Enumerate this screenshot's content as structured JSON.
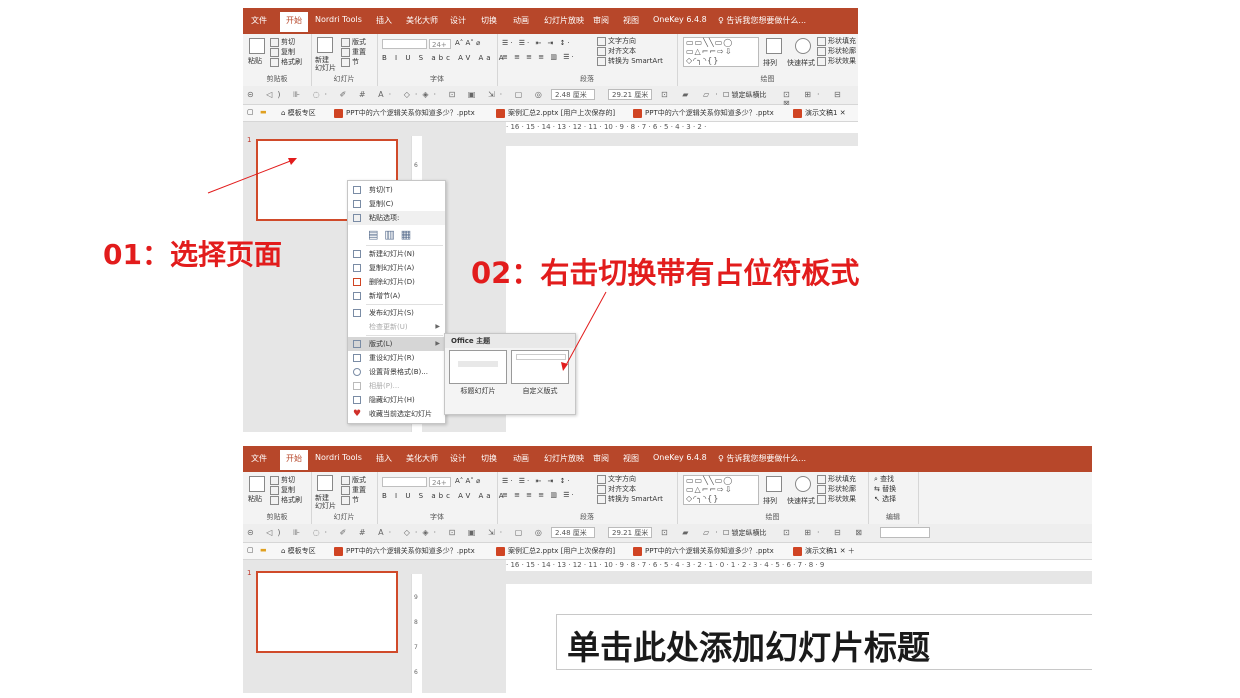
{
  "ribbon": {
    "tabs": [
      "文件",
      "开始",
      "Nordri Tools",
      "插入",
      "美化大师",
      "设计",
      "切换",
      "动画",
      "幻灯片放映",
      "审阅",
      "视图",
      "OneKey 6.4.8"
    ],
    "tell_me": "告诉我您想要做什么...",
    "clipboard": {
      "paste": "粘贴",
      "cut": "剪切",
      "copy": "复制",
      "format_painter": "格式刷",
      "label": "剪贴板"
    },
    "slides": {
      "new_slide": "新建\n幻灯片",
      "layout": "版式",
      "reset": "重置",
      "section": "节",
      "label": "幻灯片"
    },
    "font": {
      "size": "24+",
      "label": "字体"
    },
    "paragraph": {
      "text_direction": "文字方向",
      "align_text": "对齐文本",
      "smartart": "转换为 SmartArt",
      "label": "段落"
    },
    "drawing": {
      "arrange": "排列",
      "quick_styles": "快速样式",
      "shape_fill": "形状填充",
      "shape_outline": "形状轮廓",
      "shape_effects": "形状效果",
      "label": "绘图"
    },
    "editing": {
      "find": "查找",
      "replace": "替换",
      "select": "选择",
      "label": "编辑"
    }
  },
  "quick_toolbar": {
    "width_value": "2.48 厘米",
    "height_value": "29.21 厘米",
    "lock_ratio": "锁定纵横比"
  },
  "doc_tabs": {
    "template": "模板专区",
    "tabs_top": [
      "PPT中的六个逻辑关系你知道多少？.pptx",
      "案例汇总2.pptx [用户上次保存的]",
      "PPT中的六个逻辑关系你知道多少？.pptx",
      "演示文稿1"
    ],
    "tabs_bottom": [
      "PPT中的六个逻辑关系你知道多少？.pptx",
      "案例汇总2.pptx [用户上次保存的]",
      "PPT中的六个逻辑关系你知道多少？.pptx",
      "演示文稿1"
    ]
  },
  "ruler_top": "· 16 · 15 · 14 · 13 · 12 · 11 · 10 · 9 · 8 · 7 · 6 · 5 · 4 · 3 · 2 ·",
  "ruler_bottom": "· 16 · 15 · 14 · 13 · 12 · 11 · 10 · 9 · 8 · 7 · 6 · 5 · 4 · 3 · 2 · 1 · 0 · 1 · 2 · 3 · 4 · 5 · 6 · 7 · 8 · 9",
  "slide_number": "1",
  "context_menu": {
    "items": [
      {
        "label": "剪切(T)",
        "enabled": true
      },
      {
        "label": "复制(C)",
        "enabled": true
      },
      {
        "label": "粘贴选项:",
        "enabled": true
      },
      {
        "label": "新建幻灯片(N)",
        "enabled": true
      },
      {
        "label": "复制幻灯片(A)",
        "enabled": true
      },
      {
        "label": "删除幻灯片(D)",
        "enabled": true
      },
      {
        "label": "新增节(A)",
        "enabled": true
      },
      {
        "label": "发布幻灯片(S)",
        "enabled": true
      },
      {
        "label": "检查更新(U)",
        "enabled": false
      },
      {
        "label": "版式(L)",
        "enabled": true,
        "highlighted": true
      },
      {
        "label": "重设幻灯片(R)",
        "enabled": true
      },
      {
        "label": "设置背景格式(B)...",
        "enabled": true
      },
      {
        "label": "相册(P)...",
        "enabled": false
      },
      {
        "label": "隐藏幻灯片(H)",
        "enabled": true
      },
      {
        "label": "收藏当前选定幻灯片",
        "enabled": true
      }
    ]
  },
  "submenu": {
    "heading": "Office 主题",
    "layouts": [
      "标题幻灯片",
      "自定义版式"
    ]
  },
  "annotations": {
    "step1": "01：选择页面",
    "step2": "02：右击切换带有占位符板式"
  },
  "slide_title_placeholder": "单击此处添加幻灯片标题",
  "colors": {
    "accent": "#b7472a",
    "annotation": "#e21c1c"
  }
}
